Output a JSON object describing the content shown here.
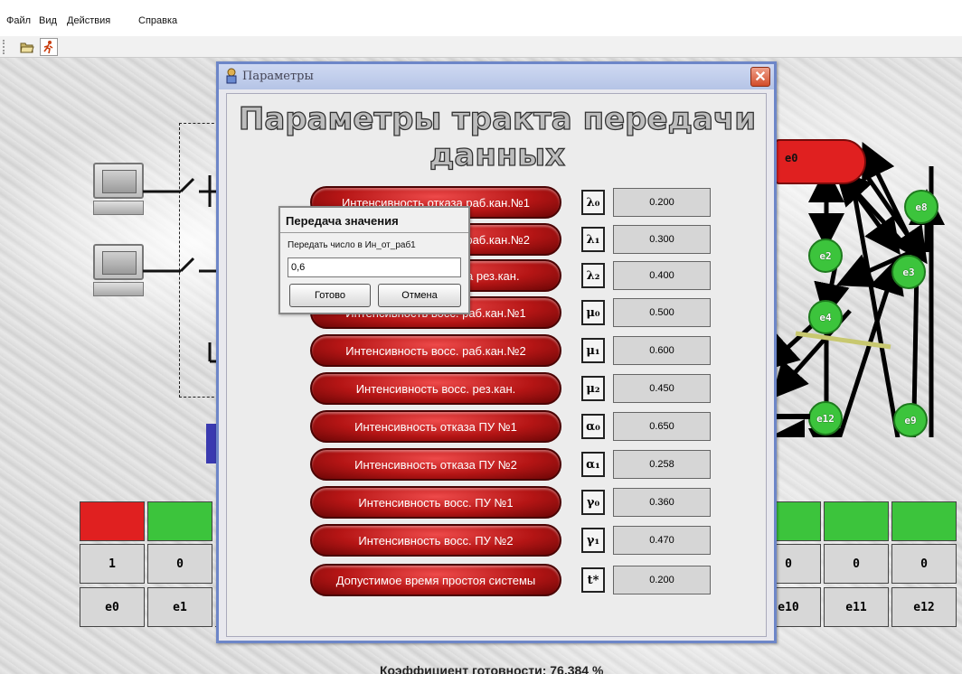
{
  "menu": [
    "Файл",
    "Вид",
    "Действия",
    "Справка"
  ],
  "toolbar": {
    "open_icon": "folder-open-icon",
    "run_icon": "run-icon"
  },
  "param_dialog": {
    "title": "Параметры",
    "heading": "Параметры тракта передачи данных",
    "rows": [
      {
        "label": "Интенсивность отказа раб.кан.№1",
        "symbol": "λ₀",
        "value": "0.200"
      },
      {
        "label": "Интенсивность отказа раб.кан.№2",
        "symbol": "λ₁",
        "value": "0.300"
      },
      {
        "label": "Интенсивность отказа рез.кан.",
        "symbol": "λ₂",
        "value": "0.400"
      },
      {
        "label": "Интенсивность восс. раб.кан.№1",
        "symbol": "μ₀",
        "value": "0.500"
      },
      {
        "label": "Интенсивность восс. раб.кан.№2",
        "symbol": "μ₁",
        "value": "0.600"
      },
      {
        "label": "Интенсивность восс. рез.кан.",
        "symbol": "μ₂",
        "value": "0.450"
      },
      {
        "label": "Интенсивность отказа ПУ №1",
        "symbol": "α₀",
        "value": "0.650"
      },
      {
        "label": "Интенсивность отказа ПУ №2",
        "symbol": "α₁",
        "value": "0.258"
      },
      {
        "label": "Интенсивность восс. ПУ №1",
        "symbol": "γ₀",
        "value": "0.360"
      },
      {
        "label": "Интенсивность восс. ПУ №2",
        "symbol": "γ₁",
        "value": "0.470"
      },
      {
        "label": "Допустимое время простоя системы",
        "symbol": "t*",
        "value": "0.200"
      }
    ]
  },
  "transfer_dialog": {
    "title": "Передача значения",
    "prompt": "Передать число в Ин_от_раб1",
    "input_value": "0,6",
    "ok_label": "Готово",
    "cancel_label": "Отмена"
  },
  "state_table": {
    "left": [
      {
        "name": "e0",
        "value": "1",
        "color": "#e02020"
      },
      {
        "name": "e1",
        "value": "0",
        "color": "#3cc43c"
      }
    ],
    "right": [
      {
        "name": "e10",
        "value": "0",
        "color": "#3cc43c"
      },
      {
        "name": "e11",
        "value": "0",
        "color": "#3cc43c"
      },
      {
        "name": "e12",
        "value": "0",
        "color": "#3cc43c"
      }
    ]
  },
  "graph": {
    "e0_label": "e0",
    "nodes": [
      "e8",
      "e2",
      "e3",
      "e4",
      "e12",
      "e9"
    ]
  },
  "readiness_text": "Коэффициент готовности: 76,384 %",
  "colors": {
    "fail": "#e02020",
    "ok": "#3cc43c",
    "button_red": "#c41616",
    "dialog_border": "#6d86c8"
  }
}
